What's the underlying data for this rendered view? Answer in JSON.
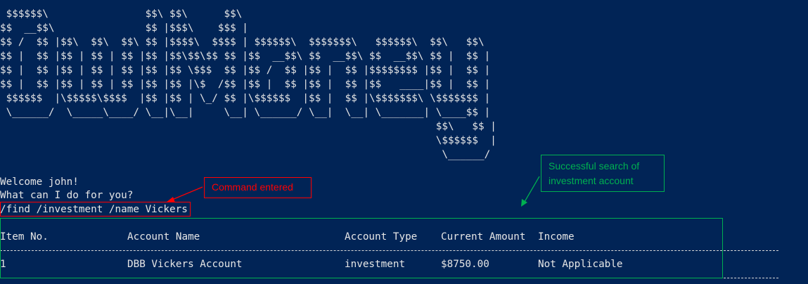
{
  "banner_art": [
    " $$$$$$\\                $$\\ $$\\      $$\\",
    "$$  __$$\\               $$ |$$$\\    $$$ |",
    "$$ /  $$ |$$\\  $$\\  $$\\ $$ |$$$$\\  $$$$ | $$$$$$\\  $$$$$$$\\   $$$$$$\\  $$\\   $$\\",
    "$$ |  $$ |$$ | $$ | $$ |$$ |$$\\$$\\$$ $$ |$$  __$$\\ $$  __$$\\ $$  __$$\\ $$ |  $$ |",
    "$$ |  $$ |$$ | $$ | $$ |$$ |$$ \\$$$  $$ |$$ /  $$ |$$ |  $$ |$$$$$$$$ |$$ |  $$ |",
    "$$ |  $$ |$$ | $$ | $$ |$$ |$$ |\\$  /$$ |$$ |  $$ |$$ |  $$ |$$   ____|$$ |  $$ |",
    " $$$$$$  |\\$$$$$\\$$$$  |$$ |$$ | \\_/ $$ |\\$$$$$$  |$$ |  $$ |\\$$$$$$$\\ \\$$$$$$$ |",
    " \\______/  \\_____\\____/ \\__|\\__|     \\__| \\______/ \\__|  \\__| \\_______| \\____$$ |",
    "                                                                        $$\\   $$ |",
    "                                                                        \\$$$$$$  |",
    "                                                                         \\______/"
  ],
  "console": {
    "welcome": "Welcome john!",
    "prompt": "What can I do for you?",
    "command": "/find /investment /name Vickers"
  },
  "table": {
    "headers": [
      "Item No.",
      "Account Name",
      "Account Type",
      "Current Amount",
      "Income"
    ],
    "rows": [
      [
        "1",
        "DBB Vickers Account",
        "investment",
        "$8750.00",
        "Not Applicable"
      ]
    ]
  },
  "annotations": {
    "command_note": "Command entered",
    "result_note": "Successful search of investment account",
    "colors": {
      "command": "#ff0000",
      "result": "#00b050",
      "background": "#012456"
    }
  }
}
